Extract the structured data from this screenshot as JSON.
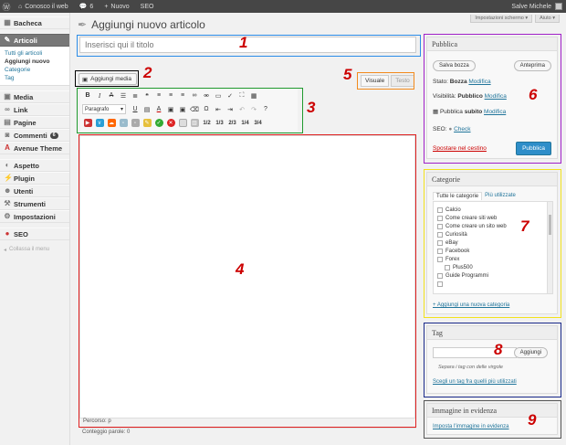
{
  "adminbar": {
    "site_name": "Conosco il web",
    "comments_count": "6",
    "new_label": "Nuovo",
    "seo_label": "SEO",
    "greeting": "Salve Michele"
  },
  "screen_options": {
    "screen_label": "Impostazioni schermo",
    "help_label": "Aiuto"
  },
  "sidebar": {
    "items": [
      {
        "label": "Bacheca",
        "icon": "dashboard-icon"
      },
      {
        "label": "Articoli",
        "icon": "pin-icon"
      },
      {
        "label": "Media",
        "icon": "media-icon"
      },
      {
        "label": "Link",
        "icon": "link-icon"
      },
      {
        "label": "Pagine",
        "icon": "page-icon"
      },
      {
        "label": "Commenti",
        "icon": "comment-icon",
        "badge": "6"
      },
      {
        "label": "Avenue Theme",
        "icon": "theme-icon"
      },
      {
        "label": "Aspetto",
        "icon": "appearance-icon"
      },
      {
        "label": "Plugin",
        "icon": "plugin-icon"
      },
      {
        "label": "Utenti",
        "icon": "users-icon"
      },
      {
        "label": "Strumenti",
        "icon": "tools-icon"
      },
      {
        "label": "Impostazioni",
        "icon": "settings-icon"
      },
      {
        "label": "SEO",
        "icon": "seo-icon"
      }
    ],
    "submenu": [
      "Tutti gli articoli",
      "Aggiungi nuovo",
      "Categorie",
      "Tag"
    ],
    "collapse_label": "Collassa il menu"
  },
  "page": {
    "title": "Aggiungi nuovo articolo",
    "title_placeholder": "Inserisci qui il titolo",
    "add_media_label": "Aggiungi media",
    "tab_visual": "Visuale",
    "tab_text": "Testo",
    "format_select": "Paragrafo",
    "path_label": "Percorso: p",
    "word_count": "Conteggio parole: 0"
  },
  "toolbar": {
    "size_labels": [
      "1/2",
      "1/3",
      "2/3",
      "1/4",
      "3/4"
    ]
  },
  "publish": {
    "heading": "Pubblica",
    "save_draft": "Salva bozza",
    "preview": "Anteprima",
    "status_label": "Stato:",
    "status_value": "Bozza",
    "visibility_label": "Visibilità:",
    "visibility_value": "Pubblico",
    "schedule_label": "Pubblica",
    "schedule_value": "subito",
    "edit_link": "Modifica",
    "seo_label": "SEO:",
    "seo_check": "Check",
    "trash_link": "Spostare nel cestino",
    "publish_button": "Pubblica"
  },
  "categories": {
    "heading": "Categorie",
    "tab_all": "Tutte le categorie",
    "tab_popular": "Più utilizzate",
    "items": [
      "Calcio",
      "Come creare siti web",
      "Come creare un sito web",
      "Curiosità",
      "eBay",
      "Facebook",
      "Forex",
      "Plus500",
      "Guide Programmi"
    ],
    "add_link": "+ Aggiungi una nuova categoria"
  },
  "tags": {
    "heading": "Tag",
    "add_button": "Aggiungi",
    "hint": "Separa i tag con delle virgole",
    "choose_link": "Scegli un tag fra quelli più utilizzati"
  },
  "featured": {
    "heading": "Immagine in evidenza",
    "set_link": "Imposta l'immagine in evidenza"
  },
  "annotations": [
    "1",
    "2",
    "3",
    "4",
    "5",
    "6",
    "7",
    "8",
    "9"
  ],
  "colors": {
    "box1": "#2b8ce8",
    "box2": "#000000",
    "box3": "#1f9a2e",
    "box4": "#e02020",
    "box5": "#f28a1c",
    "box6": "#a020c8",
    "box7": "#f2e21c",
    "box8": "#1a2a8a",
    "box9": "#555555",
    "number": "#cc0000"
  }
}
